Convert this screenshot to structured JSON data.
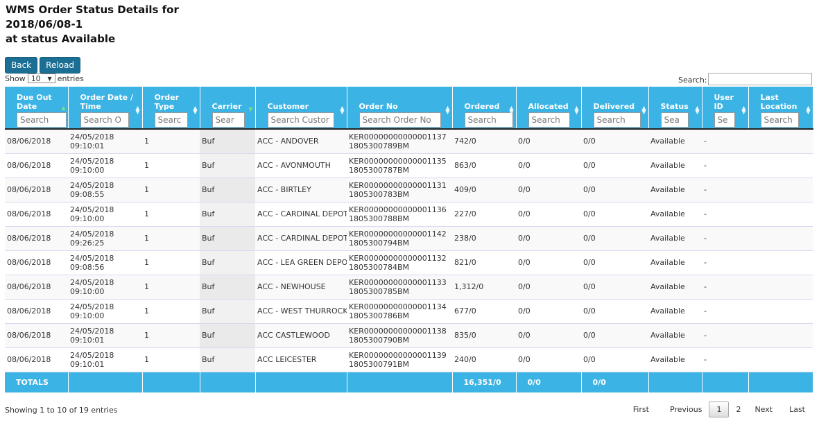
{
  "page": {
    "title_line1": "WMS Order Status Details for",
    "title_line2": "2018/06/08-1",
    "title_line3": "at status Available"
  },
  "buttons": {
    "back": "Back",
    "reload": "Reload"
  },
  "length_menu": {
    "show": "Show",
    "value": "10",
    "entries": "entries"
  },
  "search": {
    "label": "Search:"
  },
  "columns": [
    {
      "l1": "Due Out",
      "l2": "Date",
      "filter": "Search"
    },
    {
      "l1": "Order Date /",
      "l2": "Time",
      "filter": "Search O"
    },
    {
      "l1": "Order",
      "l2": "Type",
      "filter": "Searc"
    },
    {
      "l1": "",
      "l2": "Carrier",
      "filter": "Sear"
    },
    {
      "l1": "",
      "l2": "Customer",
      "filter": "Search Custor"
    },
    {
      "l1": "",
      "l2": "Order No",
      "filter": "Search Order No"
    },
    {
      "l1": "",
      "l2": "Ordered",
      "filter": "Search"
    },
    {
      "l1": "",
      "l2": "Allocated",
      "filter": "Search"
    },
    {
      "l1": "",
      "l2": "Delivered",
      "filter": "Search"
    },
    {
      "l1": "",
      "l2": "Status",
      "filter": "Sea"
    },
    {
      "l1": "User",
      "l2": "ID",
      "filter": "Se"
    },
    {
      "l1": "Last",
      "l2": "Location",
      "filter": "Search"
    }
  ],
  "rows": [
    {
      "due": "08/06/2018",
      "odate": "24/05/2018",
      "otime": "09:10:01",
      "type": "1",
      "carrier": "Buf",
      "customer": "ACC - ANDOVER",
      "ono1": "KER00000000000001137",
      "ono2": "1805300789BM",
      "ordered": "742/0",
      "allocated": "0/0",
      "delivered": "0/0",
      "status": "Available",
      "user": "-",
      "loc": ""
    },
    {
      "due": "08/06/2018",
      "odate": "24/05/2018",
      "otime": "09:10:00",
      "type": "1",
      "carrier": "Buf",
      "customer": "ACC - AVONMOUTH",
      "ono1": "KER00000000000001135",
      "ono2": "1805300787BM",
      "ordered": "863/0",
      "allocated": "0/0",
      "delivered": "0/0",
      "status": "Available",
      "user": "-",
      "loc": ""
    },
    {
      "due": "08/06/2018",
      "odate": "24/05/2018",
      "otime": "09:08:55",
      "type": "1",
      "carrier": "Buf",
      "customer": "ACC - BIRTLEY",
      "ono1": "KER00000000000001131",
      "ono2": "1805300783BM",
      "ordered": "409/0",
      "allocated": "0/0",
      "delivered": "0/0",
      "status": "Available",
      "user": "-",
      "loc": ""
    },
    {
      "due": "08/06/2018",
      "odate": "24/05/2018",
      "otime": "09:10:00",
      "type": "1",
      "carrier": "Buf",
      "customer": "ACC - CARDINAL DEPOT",
      "ono1": "KER00000000000001136",
      "ono2": "1805300788BM",
      "ordered": "227/0",
      "allocated": "0/0",
      "delivered": "0/0",
      "status": "Available",
      "user": "-",
      "loc": ""
    },
    {
      "due": "08/06/2018",
      "odate": "24/05/2018",
      "otime": "09:26:25",
      "type": "1",
      "carrier": "Buf",
      "customer": "ACC - CARDINAL DEPOT",
      "ono1": "KER00000000000001142",
      "ono2": "1805300794BM",
      "ordered": "238/0",
      "allocated": "0/0",
      "delivered": "0/0",
      "status": "Available",
      "user": "-",
      "loc": ""
    },
    {
      "due": "08/06/2018",
      "odate": "24/05/2018",
      "otime": "09:08:56",
      "type": "1",
      "carrier": "Buf",
      "customer": "ACC - LEA GREEN DEPOT",
      "ono1": "KER00000000000001132",
      "ono2": "1805300784BM",
      "ordered": "821/0",
      "allocated": "0/0",
      "delivered": "0/0",
      "status": "Available",
      "user": "-",
      "loc": ""
    },
    {
      "due": "08/06/2018",
      "odate": "24/05/2018",
      "otime": "09:10:00",
      "type": "1",
      "carrier": "Buf",
      "customer": "ACC - NEWHOUSE",
      "ono1": "KER00000000000001133",
      "ono2": "1805300785BM",
      "ordered": "1,312/0",
      "allocated": "0/0",
      "delivered": "0/0",
      "status": "Available",
      "user": "-",
      "loc": ""
    },
    {
      "due": "08/06/2018",
      "odate": "24/05/2018",
      "otime": "09:10:00",
      "type": "1",
      "carrier": "Buf",
      "customer": "ACC - WEST THURROCK",
      "ono1": "KER00000000000001134",
      "ono2": "1805300786BM",
      "ordered": "677/0",
      "allocated": "0/0",
      "delivered": "0/0",
      "status": "Available",
      "user": "-",
      "loc": ""
    },
    {
      "due": "08/06/2018",
      "odate": "24/05/2018",
      "otime": "09:10:01",
      "type": "1",
      "carrier": "Buf",
      "customer": "ACC CASTLEWOOD",
      "ono1": "KER00000000000001138",
      "ono2": "1805300790BM",
      "ordered": "835/0",
      "allocated": "0/0",
      "delivered": "0/0",
      "status": "Available",
      "user": "-",
      "loc": ""
    },
    {
      "due": "08/06/2018",
      "odate": "24/05/2018",
      "otime": "09:10:01",
      "type": "1",
      "carrier": "Buf",
      "customer": "ACC LEICESTER",
      "ono1": "KER00000000000001139",
      "ono2": "1805300791BM",
      "ordered": "240/0",
      "allocated": "0/0",
      "delivered": "0/0",
      "status": "Available",
      "user": "-",
      "loc": ""
    }
  ],
  "totals": {
    "label": "TOTALS",
    "ordered": "16,351/0",
    "allocated": "0/0",
    "delivered": "0/0"
  },
  "info": "Showing 1 to 10 of 19 entries",
  "pagination": {
    "first": "First",
    "previous": "Previous",
    "p1": "1",
    "p2": "2",
    "next": "Next",
    "last": "Last"
  },
  "colors": {
    "header_bg": "#3bb3e4",
    "button_bg": "#1b6e94",
    "sort_active": "#7fe07f"
  },
  "icons": {
    "sort": "sort-arrows-icon",
    "select": "dropdown-arrow-icon"
  }
}
